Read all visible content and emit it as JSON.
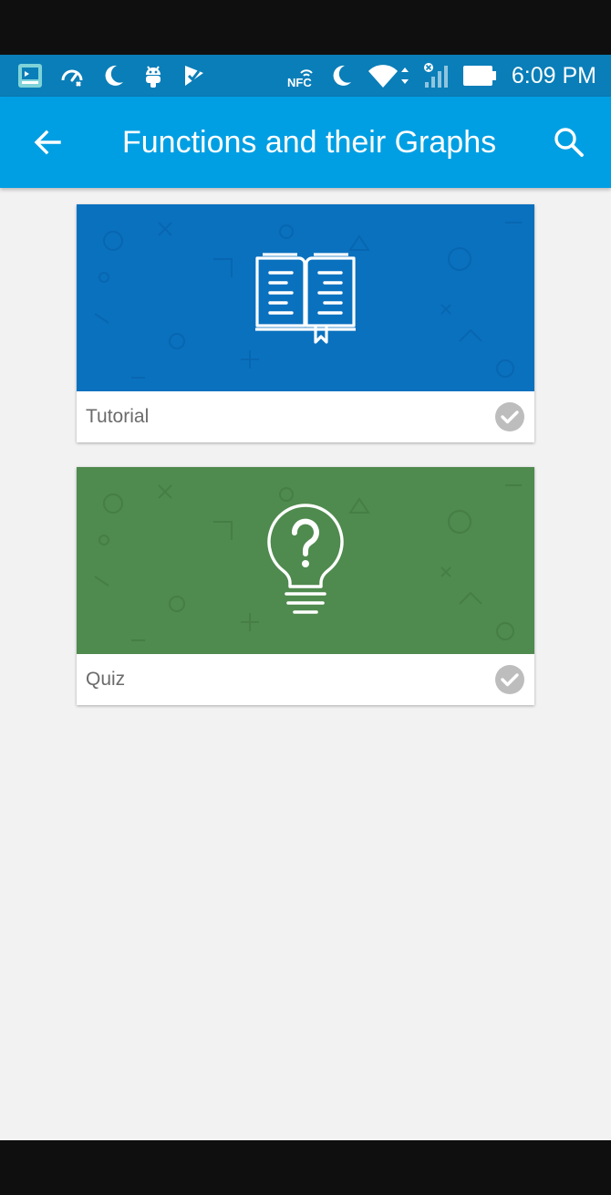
{
  "status_bar": {
    "time": "6:09 PM",
    "color": "#0a7eb8",
    "left_icons": [
      "screen-cast-icon",
      "speed-icon",
      "moon-icon",
      "android-icon",
      "checkmark-flag-icon"
    ],
    "right_icons": [
      "nfc-icon",
      "moon-icon",
      "wifi-icon",
      "signal-icon",
      "battery-icon"
    ],
    "nfc_label": "NFC"
  },
  "app_bar": {
    "title": "Functions and their Graphs",
    "color": "#009fe3",
    "back_icon": "arrow-left-icon",
    "search_icon": "search-icon"
  },
  "cards": [
    {
      "label": "Tutorial",
      "banner_color": "#0a71bf",
      "icon": "open-book-icon",
      "completed": true
    },
    {
      "label": "Quiz",
      "banner_color": "#4f8a4e",
      "icon": "lightbulb-question-icon",
      "completed": true
    }
  ],
  "content_background": "#f2f2f2"
}
